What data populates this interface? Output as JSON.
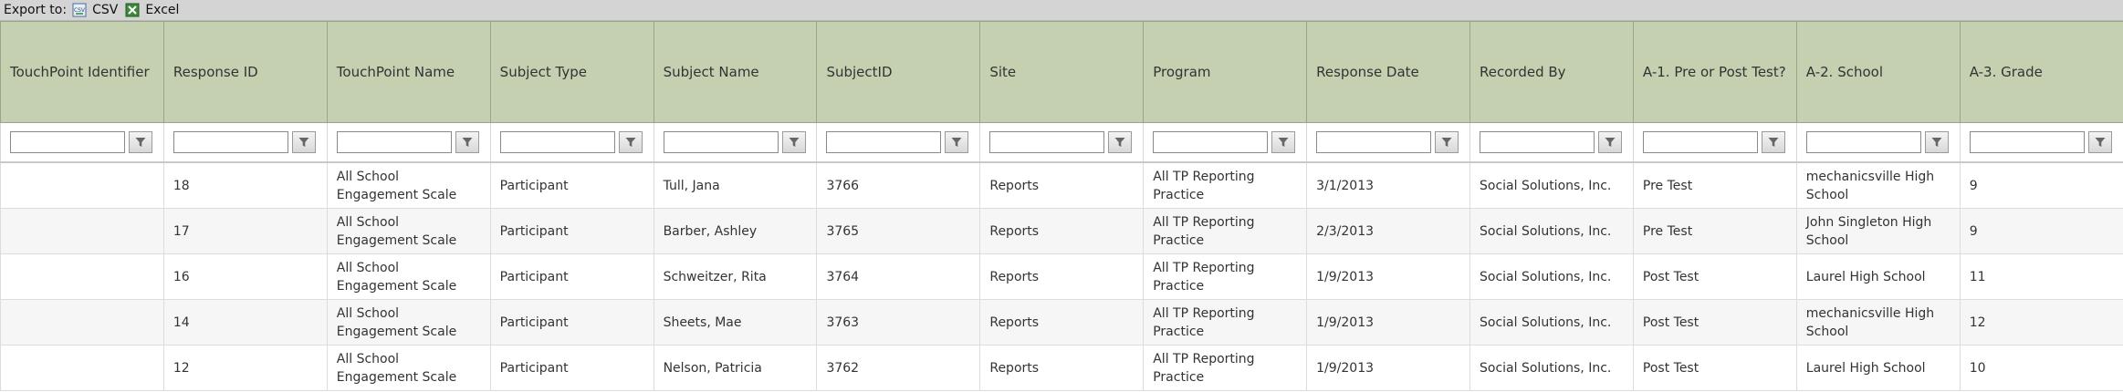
{
  "export": {
    "label": "Export to:",
    "csv_label": "CSV",
    "excel_label": "Excel"
  },
  "columns": [
    "TouchPoint Identifier",
    "Response ID",
    "TouchPoint Name",
    "Subject Type",
    "Subject Name",
    "SubjectID",
    "Site",
    "Program",
    "Response Date",
    "Recorded By",
    "A-1. Pre or Post Test?",
    "A-2. School",
    "A-3. Grade"
  ],
  "rows": [
    [
      "",
      "18",
      "All School Engagement Scale",
      "Participant",
      "Tull, Jana",
      "3766",
      "Reports",
      "All TP Reporting Practice",
      "3/1/2013",
      "Social Solutions, Inc.",
      "Pre Test",
      "mechanicsville High School",
      "9"
    ],
    [
      "",
      "17",
      "All School Engagement Scale",
      "Participant",
      "Barber, Ashley",
      "3765",
      "Reports",
      "All TP Reporting Practice",
      "2/3/2013",
      "Social Solutions, Inc.",
      "Pre Test",
      "John Singleton High School",
      "9"
    ],
    [
      "",
      "16",
      "All School Engagement Scale",
      "Participant",
      "Schweitzer, Rita",
      "3764",
      "Reports",
      "All TP Reporting Practice",
      "1/9/2013",
      "Social Solutions, Inc.",
      "Post Test",
      "Laurel High School",
      "11"
    ],
    [
      "",
      "14",
      "All School Engagement Scale",
      "Participant",
      "Sheets, Mae",
      "3763",
      "Reports",
      "All TP Reporting Practice",
      "1/9/2013",
      "Social Solutions, Inc.",
      "Post Test",
      "mechanicsville High School",
      "12"
    ],
    [
      "",
      "12",
      "All School Engagement Scale",
      "Participant",
      "Nelson, Patricia",
      "3762",
      "Reports",
      "All TP Reporting Practice",
      "1/9/2013",
      "Social Solutions, Inc.",
      "Post Test",
      "Laurel High School",
      "10"
    ]
  ],
  "icons": {
    "csv": "csv-icon",
    "excel": "excel-icon",
    "filter": "filter-icon"
  }
}
